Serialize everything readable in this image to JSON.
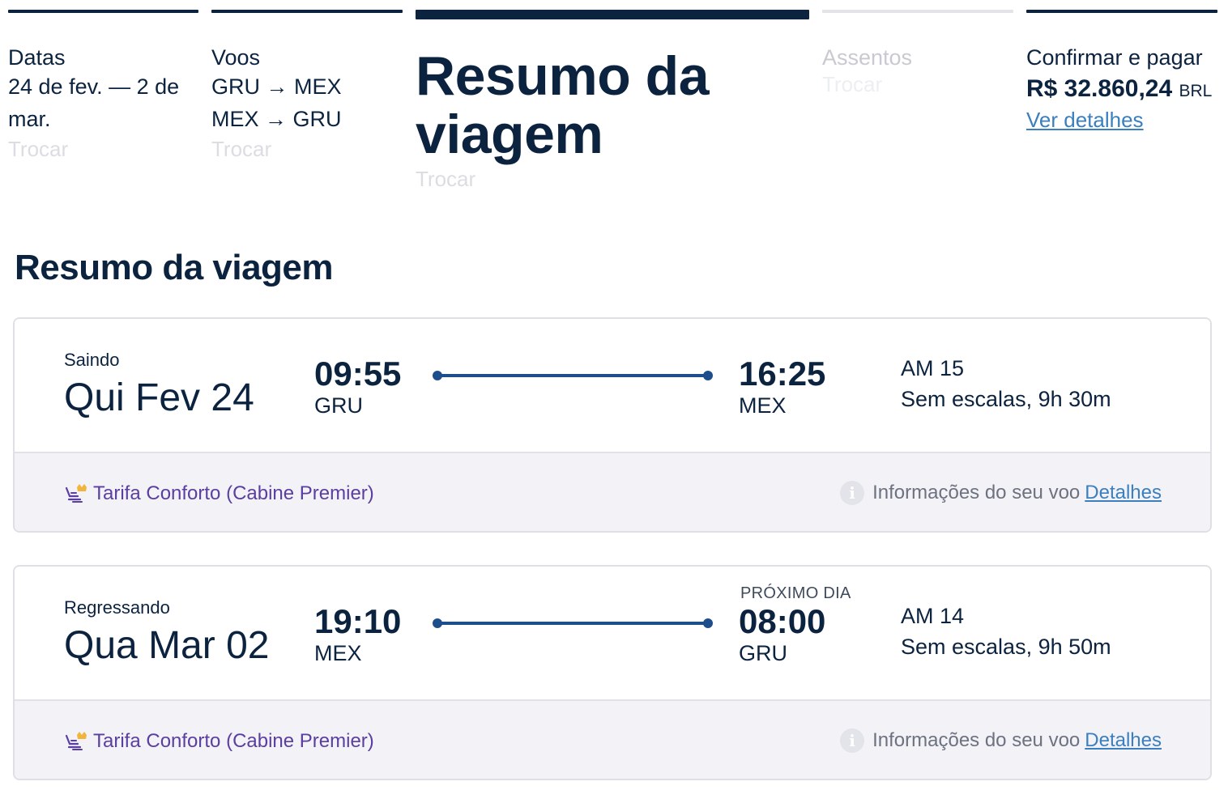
{
  "stepper": {
    "dates": {
      "title": "Datas",
      "line1": "24 de fev. — 2 de",
      "line2": "mar.",
      "change": "Trocar"
    },
    "flights": {
      "title": "Voos",
      "line1": "GRU → MEX",
      "line2": "MEX → GRU",
      "change": "Trocar"
    },
    "summary": {
      "title_line1": "Resumo da",
      "title_line2": "viagem",
      "change": "Trocar"
    },
    "seats": {
      "title": "Assentos",
      "change": "Trocar"
    },
    "pay": {
      "title": "Confirmar e pagar",
      "price": "R$ 32.860,24",
      "currency": "BRL",
      "details": "Ver detalhes"
    }
  },
  "heading": "Resumo da viagem",
  "flights": [
    {
      "direction": "Saindo",
      "date": "Qui Fev 24",
      "dep_time": "09:55",
      "dep_code": "GRU",
      "arr_time": "16:25",
      "arr_code": "MEX",
      "next_day": "",
      "flight_no": "AM 15",
      "stops": "Sem escalas, 9h 30m",
      "fare": "Tarifa Conforto (Cabine Premier)",
      "info_text": "Informações do seu voo",
      "info_link": "Detalhes"
    },
    {
      "direction": "Regressando",
      "date": "Qua Mar 02",
      "dep_time": "19:10",
      "dep_code": "MEX",
      "arr_time": "08:00",
      "arr_code": "GRU",
      "next_day": "PRÓXIMO DIA",
      "flight_no": "AM 14",
      "stops": "Sem escalas, 9h 50m",
      "fare": "Tarifa Conforto (Cabine Premier)",
      "info_text": "Informações do seu voo",
      "info_link": "Detalhes"
    }
  ],
  "icons": {
    "fare": "premier-seat-icon",
    "info": "info-icon",
    "route_start": "route-origin-dot",
    "route_end": "route-destination-dot"
  },
  "colors": {
    "primary": "#0c2340",
    "route": "#1e4d8c",
    "link": "#3b7fbf",
    "fare": "#5b3fa0",
    "crown": "#f2b43a",
    "card_footer": "#f2f2f7"
  }
}
